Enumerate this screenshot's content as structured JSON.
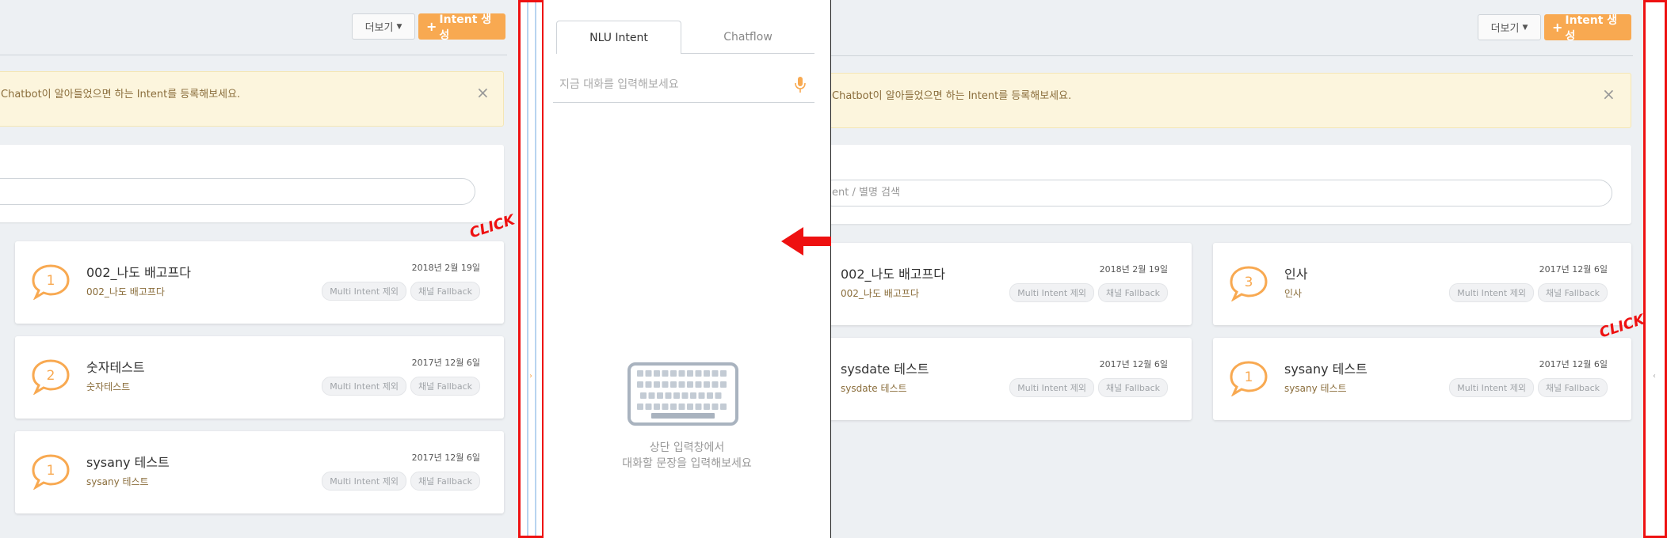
{
  "toolbar": {
    "more_label": "더보기",
    "create_label": "Intent 생성"
  },
  "alert": {
    "left_text": "Chatbot이 알아들었으면 하는 Intent를 등록해보세요.",
    "right_text": "Chatbot이 알아들었으면 하는 Intent를 등록해보세요.",
    "close": "×"
  },
  "search": {
    "left_placeholder": "",
    "right_placeholder": "ent / 별명 검색"
  },
  "left_cards": [
    {
      "count": "1",
      "name": "002_나도 배고프다",
      "alias": "002_나도 배고프다",
      "date": "2018년 2월 19일",
      "tags": [
        "Multi Intent 제외",
        "채널 Fallback"
      ]
    },
    {
      "count": "2",
      "name": "숫자테스트",
      "alias": "숫자테스트",
      "date": "2017년 12월 6일",
      "tags": [
        "Multi Intent 제외",
        "채널 Fallback"
      ]
    },
    {
      "count": "1",
      "name": "sysany 테스트",
      "alias": "sysany 테스트",
      "date": "2017년 12월 6일",
      "tags": [
        "Multi Intent 제외",
        "채널 Fallback"
      ]
    }
  ],
  "right_cards": [
    {
      "name": "002_나도 배고프다",
      "alias": "002_나도 배고프다",
      "date": "2018년 2월 19일",
      "tags": [
        "Multi Intent 제외",
        "채널 Fallback"
      ]
    },
    {
      "count": "3",
      "name": "인사",
      "alias": "인사",
      "date": "2017년 12월 6일",
      "tags": [
        "Multi Intent 제외",
        "채널 Fallback"
      ]
    },
    {
      "name": "sysdate 테스트",
      "alias": "sysdate 테스트",
      "date": "2017년 12월 6일",
      "tags": [
        "Multi Intent 제외",
        "채널 Fallback"
      ]
    },
    {
      "count": "1",
      "name": "sysany 테스트",
      "alias": "sysany 테스트",
      "date": "2017년 12월 6일",
      "tags": [
        "Multi Intent 제외",
        "채널 Fallback"
      ]
    }
  ],
  "test_panel": {
    "tabs": [
      "NLU Intent",
      "Chatflow"
    ],
    "input_placeholder": "지금 대화를 입력해보세요",
    "empty_line1": "상단 입력창에서",
    "empty_line2": "대화할 문장을 입력해보세요"
  },
  "annotations": {
    "click_left": "CLICK",
    "click_right": "CLICK"
  },
  "colors": {
    "accent": "#f8a951",
    "annotation": "#ee1111",
    "background": "#edf0f3"
  },
  "icons": [
    "caret-down-icon",
    "plus-icon",
    "close-icon",
    "speech-bubble-icon",
    "microphone-icon",
    "keyboard-icon",
    "double-arrow-icon",
    "chevron-right-icon",
    "chevron-left-icon"
  ]
}
